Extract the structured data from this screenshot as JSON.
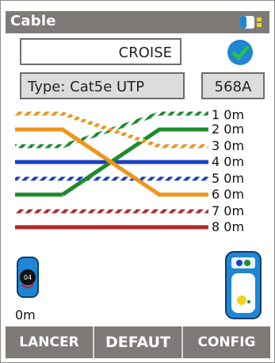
{
  "header": {
    "title": "Cable",
    "battery_icon": "battery-icon"
  },
  "result": {
    "value": "CROISE",
    "status_icon": "check-circle-icon",
    "status_color": "#1f86d4"
  },
  "cable": {
    "type_label": "Type: Cat5e UTP",
    "standard": "568A"
  },
  "wires": [
    {
      "label": "1 0m",
      "color": "#f0941c",
      "striped": true
    },
    {
      "label": "2 0m",
      "color": "#1f8b2c",
      "striped": false
    },
    {
      "label": "3 0m",
      "color": "#1f8b2c",
      "striped": true
    },
    {
      "label": "4 0m",
      "color": "#1a3fc4",
      "striped": false
    },
    {
      "label": "5 0m",
      "color": "#1a3fc4",
      "striped": true
    },
    {
      "label": "6 0m",
      "color": "#f0941c",
      "striped": false
    },
    {
      "label": "7 0m",
      "color": "#b4262a",
      "striped": true
    },
    {
      "label": "8 0m",
      "color": "#b4262a",
      "striped": false
    }
  ],
  "remote": {
    "distance": "0m",
    "icon": "remote-unit-icon"
  },
  "tester": {
    "icon": "tester-device-icon"
  },
  "softkeys": {
    "left": "LANCER",
    "middle": "DEFAUT",
    "right": "CONFIG"
  }
}
